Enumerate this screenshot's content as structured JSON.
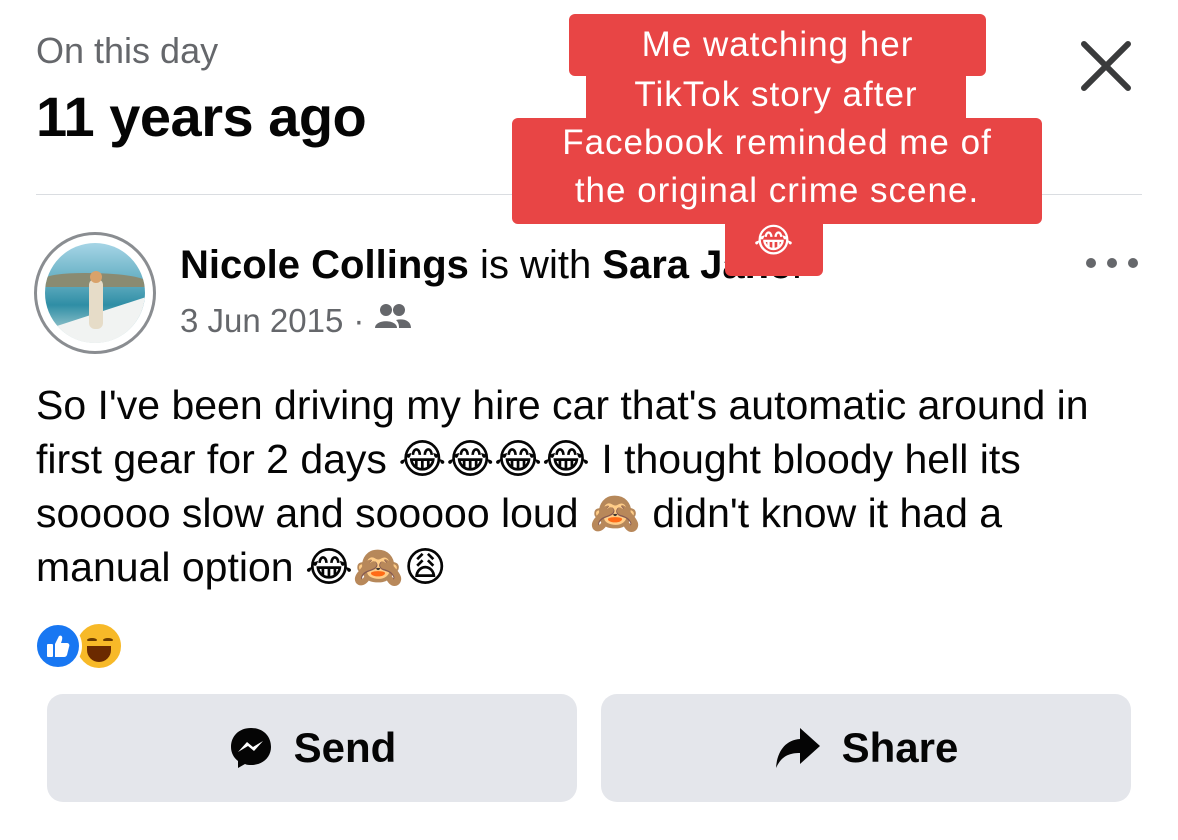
{
  "header": {
    "kicker": "On this day",
    "headline": "11 years ago"
  },
  "post": {
    "author": "Nicole Collings",
    "with_text": " is with ",
    "tagged": "Sara Jane",
    "period": ".",
    "date": "3 Jun 2015",
    "separator": "·",
    "audience_icon": "friends-icon",
    "body": "So I've been driving my hire car that's automatic around in first gear for 2 days 😂😂😂😂 I thought bloody hell its sooooo slow and sooooo loud 🙈 didn't know it had a manual option 😂🙈😩",
    "reactions": [
      "like",
      "haha"
    ]
  },
  "actions": {
    "send_label": "Send",
    "share_label": "Share"
  },
  "caption": {
    "line1": "Me watching her",
    "line2": "TikTok story after",
    "line3": "Facebook reminded me of",
    "line4": "the original crime scene.",
    "line5": "😂"
  },
  "colors": {
    "caption_bg": "#e84545",
    "like_blue": "#1877f2",
    "secondary_text": "#65676b",
    "button_bg": "#e4e6eb"
  }
}
